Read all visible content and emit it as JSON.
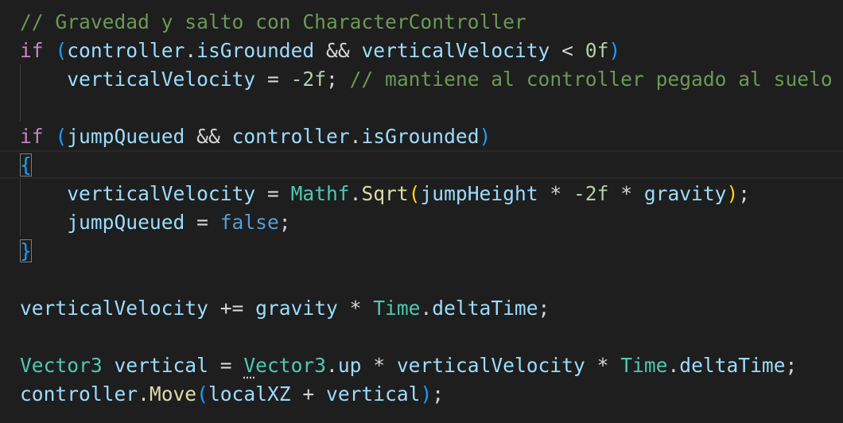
{
  "editor": {
    "lines": [
      [
        {
          "t": "// Gravedad y salto con CharacterController",
          "k": "comment"
        }
      ],
      [
        {
          "t": "if",
          "k": "keyword"
        },
        {
          "t": " ",
          "k": "op"
        },
        {
          "t": "(",
          "k": "paren1"
        },
        {
          "t": "controller",
          "k": "var"
        },
        {
          "t": ".",
          "k": "op"
        },
        {
          "t": "isGrounded",
          "k": "var"
        },
        {
          "t": " && ",
          "k": "op"
        },
        {
          "t": "verticalVelocity",
          "k": "var"
        },
        {
          "t": " < ",
          "k": "op"
        },
        {
          "t": "0f",
          "k": "num"
        },
        {
          "t": ")",
          "k": "paren1"
        }
      ],
      [
        {
          "t": "    ",
          "k": "op"
        },
        {
          "t": "verticalVelocity",
          "k": "var"
        },
        {
          "t": " = ",
          "k": "op"
        },
        {
          "t": "-2f",
          "k": "num"
        },
        {
          "t": "; ",
          "k": "op"
        },
        {
          "t": "// mantiene al controller pegado al suelo",
          "k": "comment"
        }
      ],
      [],
      [
        {
          "t": "if",
          "k": "keyword"
        },
        {
          "t": " ",
          "k": "op"
        },
        {
          "t": "(",
          "k": "paren1"
        },
        {
          "t": "jumpQueued",
          "k": "var"
        },
        {
          "t": " && ",
          "k": "op"
        },
        {
          "t": "controller",
          "k": "var"
        },
        {
          "t": ".",
          "k": "op"
        },
        {
          "t": "isGrounded",
          "k": "var"
        },
        {
          "t": ")",
          "k": "paren1"
        }
      ],
      [
        {
          "t": "{",
          "k": "paren1",
          "m": true
        }
      ],
      [
        {
          "t": "    ",
          "k": "op"
        },
        {
          "t": "verticalVelocity",
          "k": "var"
        },
        {
          "t": " = ",
          "k": "op"
        },
        {
          "t": "Mathf",
          "k": "type"
        },
        {
          "t": ".",
          "k": "op"
        },
        {
          "t": "Sqrt",
          "k": "func"
        },
        {
          "t": "(",
          "k": "paren2"
        },
        {
          "t": "jumpHeight",
          "k": "var"
        },
        {
          "t": " * ",
          "k": "op"
        },
        {
          "t": "-2f",
          "k": "num"
        },
        {
          "t": " * ",
          "k": "op"
        },
        {
          "t": "gravity",
          "k": "var"
        },
        {
          "t": ")",
          "k": "paren2"
        },
        {
          "t": ";",
          "k": "op"
        }
      ],
      [
        {
          "t": "    ",
          "k": "op"
        },
        {
          "t": "jumpQueued",
          "k": "var"
        },
        {
          "t": " = ",
          "k": "op"
        },
        {
          "t": "false",
          "k": "const"
        },
        {
          "t": ";",
          "k": "op"
        }
      ],
      [
        {
          "t": "}",
          "k": "paren1",
          "m": true
        }
      ],
      [],
      [
        {
          "t": "verticalVelocity",
          "k": "var"
        },
        {
          "t": " += ",
          "k": "op"
        },
        {
          "t": "gravity",
          "k": "var"
        },
        {
          "t": " * ",
          "k": "op"
        },
        {
          "t": "Time",
          "k": "type"
        },
        {
          "t": ".",
          "k": "op"
        },
        {
          "t": "deltaTime",
          "k": "var"
        },
        {
          "t": ";",
          "k": "op"
        }
      ],
      [],
      [
        {
          "t": "Vector3",
          "k": "type"
        },
        {
          "t": " ",
          "k": "op"
        },
        {
          "t": "vertical",
          "k": "var"
        },
        {
          "t": " = ",
          "k": "op"
        },
        {
          "t": "V",
          "k": "type",
          "s": true
        },
        {
          "t": "ector3",
          "k": "type"
        },
        {
          "t": ".",
          "k": "op"
        },
        {
          "t": "up",
          "k": "var"
        },
        {
          "t": " * ",
          "k": "op"
        },
        {
          "t": "verticalVelocity",
          "k": "var"
        },
        {
          "t": " * ",
          "k": "op"
        },
        {
          "t": "Time",
          "k": "type"
        },
        {
          "t": ".",
          "k": "op"
        },
        {
          "t": "deltaTime",
          "k": "var"
        },
        {
          "t": ";",
          "k": "op"
        }
      ],
      [
        {
          "t": "controller",
          "k": "var"
        },
        {
          "t": ".",
          "k": "op"
        },
        {
          "t": "Move",
          "k": "func"
        },
        {
          "t": "(",
          "k": "paren1"
        },
        {
          "t": "localXZ",
          "k": "var"
        },
        {
          "t": " + ",
          "k": "op"
        },
        {
          "t": "vertical",
          "k": "var"
        },
        {
          "t": ")",
          "k": "paren1"
        },
        {
          "t": ";",
          "k": "op"
        }
      ]
    ]
  }
}
